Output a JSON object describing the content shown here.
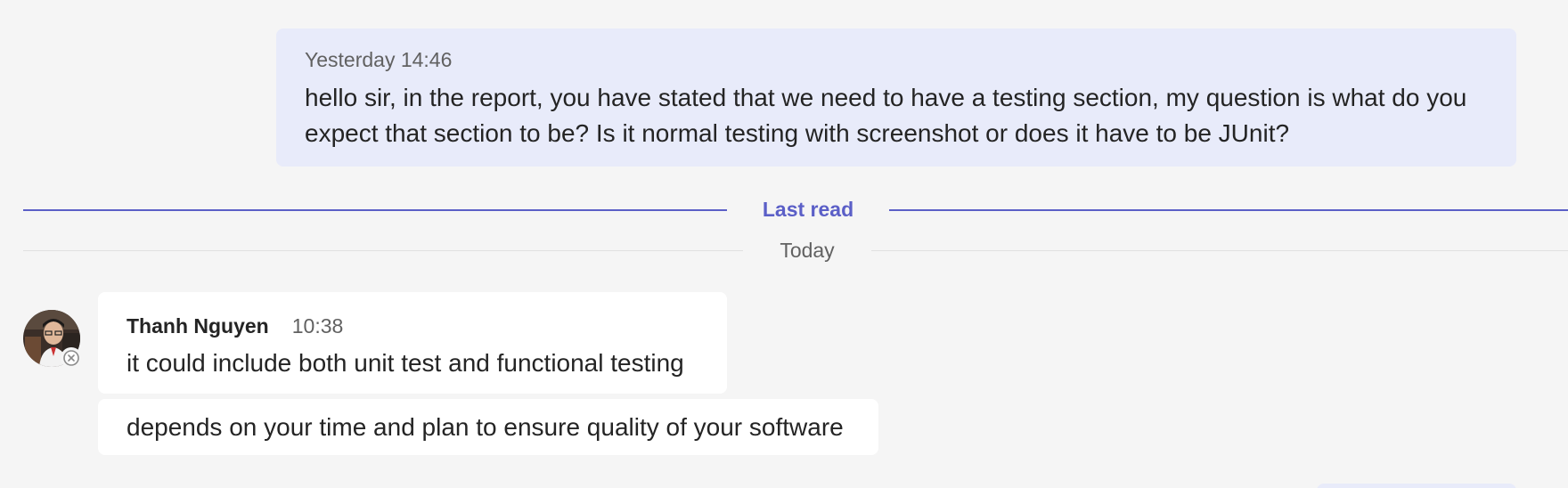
{
  "chat": {
    "sent_message": {
      "timestamp": "Yesterday 14:46",
      "text": "hello sir, in the report, you have stated that we need to have a testing section, my question is what do you expect that section to be? Is it normal testing with screenshot or does it have to be JUnit?"
    },
    "last_read_label": "Last read",
    "date_divider_label": "Today",
    "received_messages": {
      "sender_name": "Thanh Nguyen",
      "timestamp": "10:38",
      "avatar_icon": "person-photo-avatar",
      "status_icon": "offline-status-icon",
      "items": [
        {
          "text": "it could include both unit test and functional testing"
        },
        {
          "text": "depends on your time and plan to ensure quality of your software"
        }
      ]
    }
  },
  "colors": {
    "background": "#f5f5f5",
    "sent_bubble": "#e8ebfa",
    "received_bubble": "#ffffff",
    "accent": "#5b5fc7",
    "secondary_text": "#616161",
    "primary_text": "#242424"
  }
}
